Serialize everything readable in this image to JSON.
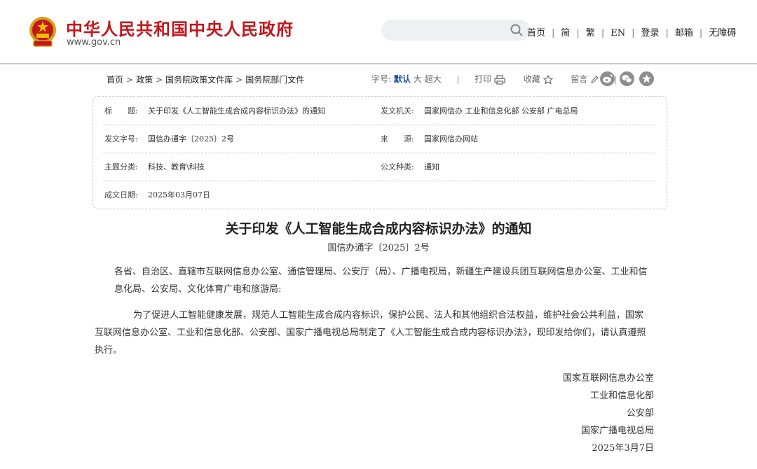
{
  "header": {
    "site_name": "中华人民共和国中央人民政府",
    "site_url": "www.gov.cn",
    "search_placeholder": "",
    "nav": [
      "首页",
      "简",
      "繁",
      "EN",
      "登录",
      "邮箱",
      "无障碍"
    ]
  },
  "breadcrumb": [
    "首页",
    "政策",
    "国务院政策文件库",
    "国务院部门文件"
  ],
  "tools": {
    "font_label": "字号:",
    "font_default": "默认",
    "font_large": "大",
    "font_xlarge": "超大",
    "print": "打印",
    "favorite": "收藏",
    "comment": "留言"
  },
  "share_icons": [
    "weibo-icon",
    "wechat-icon",
    "star-circle-icon"
  ],
  "info": {
    "title_label": "标　　题:",
    "title_value": "关于印发《人工智能生成合成内容标识办法》的通知",
    "issuer_label": "发文机关:",
    "issuer_value": "国家网信办 工业和信息化部 公安部 广电总局",
    "docno_label": "发文字号:",
    "docno_value": "国信办通字〔2025〕2号",
    "source_label": "来　　源:",
    "source_value": "国家网信办网站",
    "category_label": "主题分类:",
    "category_value": "科技、教育\\科技",
    "type_label": "公文种类:",
    "type_value": "通知",
    "date_label": "成文日期:",
    "date_value": "2025年03月07日"
  },
  "document": {
    "title": "关于印发《人工智能生成合成内容标识办法》的通知",
    "number": "国信办通字〔2025〕2号",
    "salutation": "各省、自治区、直辖市互联网信息办公室、通信管理局、公安厅（局）、广播电视局，新疆生产建设兵团互联网信息办公室、工业和信息化局、公安局、文化体育广电和旅游局:",
    "body": "为了促进人工智能健康发展，规范人工智能生成合成内容标识，保护公民、法人和其他组织合法权益，维护社会公共利益，国家互联网信息办公室、工业和信息化部、公安部、国家广播电视总局制定了《人工智能生成合成内容标识办法》，现印发给你们，请认真遵照执行。",
    "signatories": [
      "国家互联网信息办公室",
      "工业和信息化部",
      "公安部",
      "国家广播电视总局"
    ],
    "sign_date": "2025年3月7日"
  },
  "colors": {
    "brand_red": "#c4161c",
    "link_blue": "#1a4f9c",
    "icon_gray": "#8e8e8e"
  }
}
